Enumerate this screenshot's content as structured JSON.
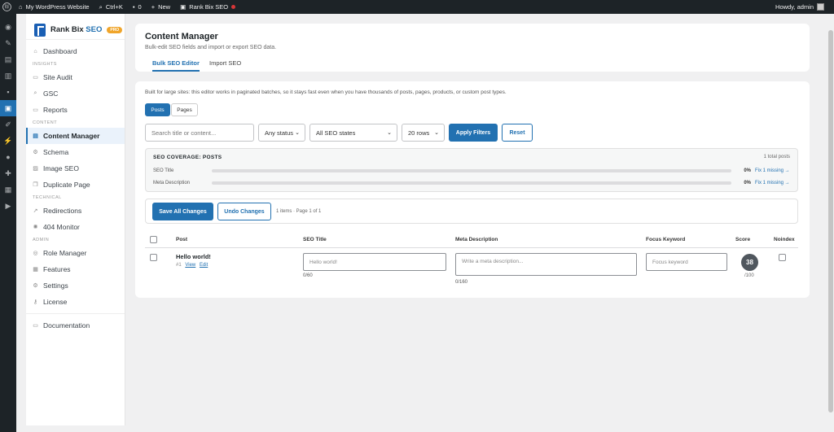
{
  "adminbar": {
    "site_name": "My WordPress Website",
    "shortcut": "Ctrl+K",
    "comments_count": "0",
    "new_label": "New",
    "plugin_label": "Rank Bix SEO",
    "howdy": "Howdy, admin"
  },
  "brand": {
    "name": "Rank Bix",
    "name_accent": "SEO",
    "badge": "PRO"
  },
  "nav": {
    "dashboard": "Dashboard",
    "section_insights": "INSIGHTS",
    "site_audit": "Site Audit",
    "gsc": "GSC",
    "reports": "Reports",
    "section_content": "CONTENT",
    "content_manager": "Content Manager",
    "schema": "Schema",
    "image_seo": "Image SEO",
    "duplicate_page": "Duplicate Page",
    "section_technical": "TECHNICAL",
    "redirections": "Redirections",
    "monitor_404": "404 Monitor",
    "section_admin": "ADMIN",
    "role_manager": "Role Manager",
    "features": "Features",
    "settings": "Settings",
    "license": "License",
    "documentation": "Documentation"
  },
  "header": {
    "title": "Content Manager",
    "subtitle": "Bulk-edit SEO fields and import or export SEO data.",
    "tabs": [
      {
        "label": "Bulk SEO Editor"
      },
      {
        "label": "Import SEO"
      }
    ]
  },
  "editor": {
    "info": "Built for large sites: this editor works in paginated batches, so it stays fast even when you have thousands of posts, pages, products, or custom post types.",
    "type_tabs": [
      {
        "label": "Posts"
      },
      {
        "label": "Pages"
      }
    ],
    "filters": {
      "search_placeholder": "Search title or content...",
      "status": "Any status",
      "seo_state": "All SEO states",
      "rows": "20 rows",
      "apply": "Apply Filters",
      "reset": "Reset"
    },
    "coverage": {
      "title": "SEO COVERAGE: POSTS",
      "total": "1 total posts",
      "rows": [
        {
          "label": "SEO Title",
          "percent": "0%",
          "percent_value": 0,
          "fix": "Fix 1 missing →"
        },
        {
          "label": "Meta Description",
          "percent": "0%",
          "percent_value": 0,
          "fix": "Fix 1 missing →"
        }
      ]
    },
    "actions": {
      "save_all": "Save All Changes",
      "undo": "Undo Changes",
      "items_info": "1 items · Page 1 of 1"
    },
    "table": {
      "headers": {
        "post": "Post",
        "seo_title": "SEO Title",
        "meta_description": "Meta Description",
        "focus_keyword": "Focus Keyword",
        "score": "Score",
        "noindex": "Noindex"
      },
      "rows": [
        {
          "title": "Hello world!",
          "id": "#1",
          "view": "View",
          "edit": "Edit",
          "seo_title_placeholder": "Hello world!",
          "seo_title_counter": "0/60",
          "meta_placeholder": "Write a meta description...",
          "meta_counter": "0/160",
          "keyword_placeholder": "Focus keyword",
          "score": "38",
          "score_max": "/100"
        }
      ]
    }
  },
  "colors": {
    "accent": "#2271b1",
    "admin_bar": "#1d2327",
    "pro_badge": "#f0a52a"
  }
}
